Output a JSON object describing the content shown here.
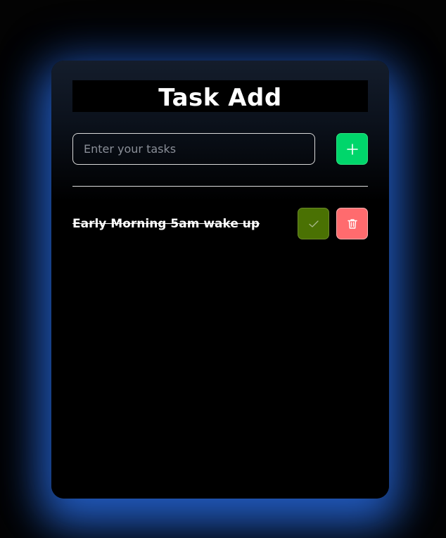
{
  "app": {
    "title": "Task Add"
  },
  "input": {
    "placeholder": "Enter your tasks",
    "value": ""
  },
  "buttons": {
    "add_icon": "plus-icon",
    "complete_icon": "check-icon",
    "delete_icon": "trash-icon"
  },
  "tasks": [
    {
      "text": "Early Morning 5am wake up",
      "completed": true
    }
  ],
  "colors": {
    "add": "#00d66b",
    "complete": "#4a7103",
    "delete": "#ff6b6e",
    "glow": "#286ee6"
  }
}
